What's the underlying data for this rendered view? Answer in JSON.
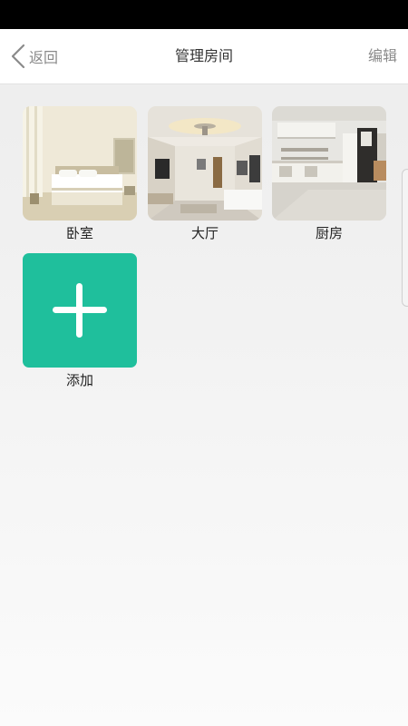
{
  "nav": {
    "back_label": "返回",
    "title": "管理房间",
    "edit_label": "编辑"
  },
  "rooms": [
    {
      "label": "卧室",
      "image": "bedroom-photo"
    },
    {
      "label": "大厅",
      "image": "living-room-photo"
    },
    {
      "label": "厨房",
      "image": "kitchen-photo"
    }
  ],
  "add_tile": {
    "label": "添加",
    "icon": "plus-icon",
    "color": "#1fbf9c"
  },
  "colors": {
    "accent": "#1fbf9c",
    "nav_text": "#8a8a8a",
    "title_text": "#333333",
    "status_bar": "#000000"
  }
}
